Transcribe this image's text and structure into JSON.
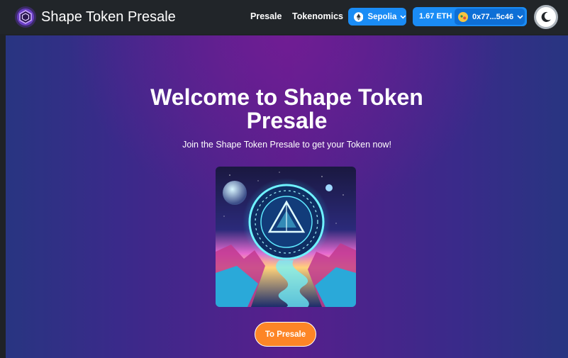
{
  "app": {
    "title": "Shape Token Presale",
    "logo_icon": "hexagon-logo-icon"
  },
  "nav": {
    "links": [
      {
        "label": "Presale"
      },
      {
        "label": "Tokenomics"
      }
    ]
  },
  "wallet": {
    "network": {
      "label": "Sepolia",
      "icon": "ethereum-icon"
    },
    "balance": "1.67 ETH",
    "address": "0x77...5c46",
    "avatar_icon": "wallet-avatar-icon"
  },
  "theme_toggle": {
    "icon": "moon-icon"
  },
  "hero": {
    "title_line1": "Welcome to Shape Token",
    "title_line2": "Presale",
    "subtitle": "Join the Shape Token Presale to get your Token now!",
    "cta_label": "To Presale"
  },
  "colors": {
    "navbar_bg": "#212529",
    "accent_blue": "#1a8cf5",
    "cta_orange": "#fd8526",
    "hero_purple": "#571f8c",
    "hero_blue": "#283581"
  }
}
